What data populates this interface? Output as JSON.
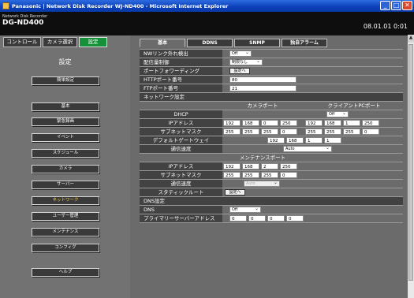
{
  "window": {
    "title": "Panasonic | Network Disk Recorder WJ-ND400 - Microsoft Internet Explorer"
  },
  "header": {
    "model_small": "Network Disk Recorder",
    "model": "DG-ND400",
    "datetime": "08.01.01 0:01"
  },
  "main_tabs": [
    {
      "label": "コントロール"
    },
    {
      "label": "カメラ選択"
    },
    {
      "label": "設定"
    }
  ],
  "sidebar": {
    "title": "設定",
    "items": [
      {
        "label": "簡単設定"
      },
      {
        "label": "基本"
      },
      {
        "label": "緊急録画"
      },
      {
        "label": "イベント"
      },
      {
        "label": "スケジュール"
      },
      {
        "label": "カメラ"
      },
      {
        "label": "サーバー"
      },
      {
        "label": "ネットワーク"
      },
      {
        "label": "ユーザー管理"
      },
      {
        "label": "メンテナンス"
      },
      {
        "label": "コンフィグ"
      },
      {
        "label": "ヘルプ"
      }
    ]
  },
  "sub_tabs": [
    {
      "label": "基本"
    },
    {
      "label": "DDNS"
    },
    {
      "label": "SNMP"
    },
    {
      "label": "独自アラーム"
    }
  ],
  "form": {
    "nw_link": {
      "label": "NWリンク外れ検出",
      "value": "Off"
    },
    "delivery": {
      "label": "配信量制御",
      "value": "制限なし"
    },
    "port_forward": {
      "label": "ポートフォワーディング",
      "button": "設定へ"
    },
    "http_port": {
      "label": "HTTPポート番号",
      "value": "80"
    },
    "ftp_port": {
      "label": "FTPポート番号",
      "value": "21"
    },
    "network_section": "ネットワーク設定",
    "camera_port": "カメラポート",
    "client_port": "クライアントPCポート",
    "dhcp": {
      "label": "DHCP",
      "value": "Off"
    },
    "ip": {
      "label": "IPアドレス",
      "camera": [
        "192",
        "168",
        "0",
        "250"
      ],
      "client": [
        "192",
        "168",
        "1",
        "250"
      ]
    },
    "subnet": {
      "label": "サブネットマスク",
      "camera": [
        "255",
        "255",
        "255",
        "0"
      ],
      "client": [
        "255",
        "255",
        "255",
        "0"
      ]
    },
    "gateway": {
      "label": "デフォルトゲートウェイ",
      "value": [
        "192",
        "168",
        "1",
        "1"
      ]
    },
    "speed": {
      "label": "通信速度",
      "value": "Auto"
    },
    "maint_port": "メンテナンスポート",
    "maint_ip": {
      "label": "IPアドレス",
      "value": [
        "192",
        "168",
        "2",
        "250"
      ]
    },
    "maint_subnet": {
      "label": "サブネットマスク",
      "value": [
        "255",
        "255",
        "255",
        "0"
      ]
    },
    "maint_speed": {
      "label": "通信速度",
      "value": "Auto"
    },
    "static_route": {
      "label": "スタティックルート",
      "button": "設定へ"
    },
    "dns_section": "DNS設定",
    "dns": {
      "label": "DNS",
      "value": "Off"
    },
    "primary_dns": {
      "label": "プライマリーサーバーアドレス",
      "value": [
        "0",
        "0",
        "0",
        "0"
      ]
    }
  }
}
